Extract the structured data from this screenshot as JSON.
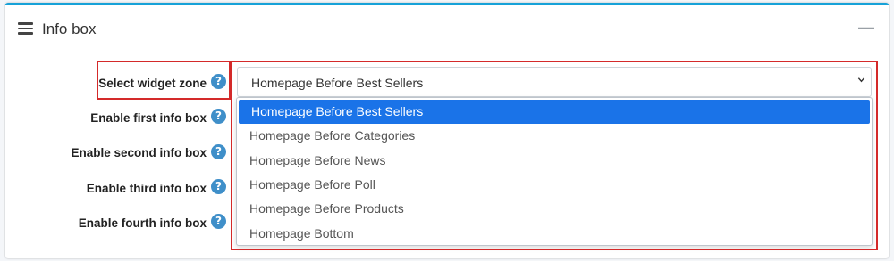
{
  "card": {
    "title": "Info box",
    "collapse_symbol": "—",
    "icon": "menu-lines-icon"
  },
  "fields": [
    {
      "label": "Select widget zone",
      "help": "?"
    },
    {
      "label": "Enable first info box",
      "help": "?"
    },
    {
      "label": "Enable second info box",
      "help": "?"
    },
    {
      "label": "Enable third info box",
      "help": "?"
    },
    {
      "label": "Enable fourth info box",
      "help": "?"
    }
  ],
  "widget_zone": {
    "selected": "Homepage Before Best Sellers",
    "options": [
      "Homepage Before Best Sellers",
      "Homepage Before Categories",
      "Homepage Before News",
      "Homepage Before Poll",
      "Homepage Before Products",
      "Homepage Bottom"
    ]
  },
  "colors": {
    "accent_border": "#17a2d8",
    "help_icon": "#3f8fc9",
    "highlight_red": "#d42a2a",
    "selected_option": "#1a73e8"
  }
}
